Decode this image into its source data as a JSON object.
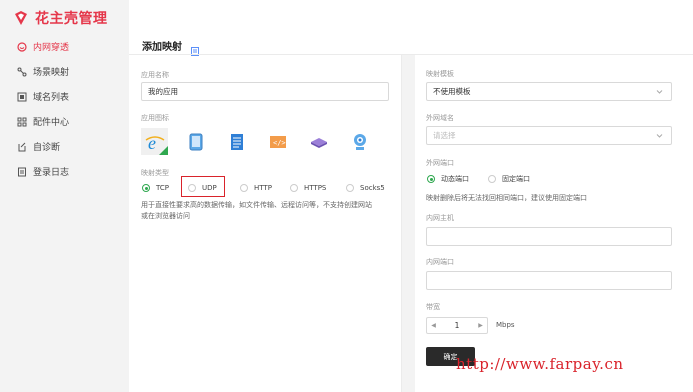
{
  "brand": {
    "name": "花主壳管理",
    "accent": "#e5374a"
  },
  "sidebar": {
    "items": [
      {
        "label": "内网穿透",
        "icon": "smile-circle-icon",
        "active": true
      },
      {
        "label": "场景映射",
        "icon": "nodes-icon",
        "active": false
      },
      {
        "label": "域名列表",
        "icon": "list-box-icon",
        "active": false
      },
      {
        "label": "配件中心",
        "icon": "grid-icon",
        "active": false
      },
      {
        "label": "自诊断",
        "icon": "diagnose-icon",
        "active": false
      },
      {
        "label": "登录日志",
        "icon": "log-icon",
        "active": false
      }
    ]
  },
  "page": {
    "title": "添加映射"
  },
  "left": {
    "app_name_label": "应用名称",
    "app_name_value": "我的应用",
    "app_icon_label": "应用图标",
    "mapping_type_label": "映射类型",
    "mapping_types": [
      "TCP",
      "UDP",
      "HTTP",
      "HTTPS",
      "Socks5"
    ],
    "selected_type": "TCP",
    "description": [
      "用于直接性要求高的数据传输，如文件传输、远程访问等，不支持创建网站",
      "或在浏览器访问"
    ]
  },
  "right": {
    "template_label": "映射模板",
    "template_value": "不使用模板",
    "domain_label": "外网域名",
    "domain_placeholder": "请选择",
    "port_label": "外网端口",
    "port_options": [
      "动态端口",
      "固定端口"
    ],
    "selected_port": "动态端口",
    "port_note": "映射删除后将无法找回相同端口，建议使用固定端口",
    "host_label": "内网主机",
    "inner_port_label": "内网端口",
    "bandwidth_label": "带宽",
    "bandwidth_value": "1",
    "bandwidth_unit": "Mbps",
    "confirm_label": "确定"
  },
  "watermark": "http://www.farpay.cn"
}
